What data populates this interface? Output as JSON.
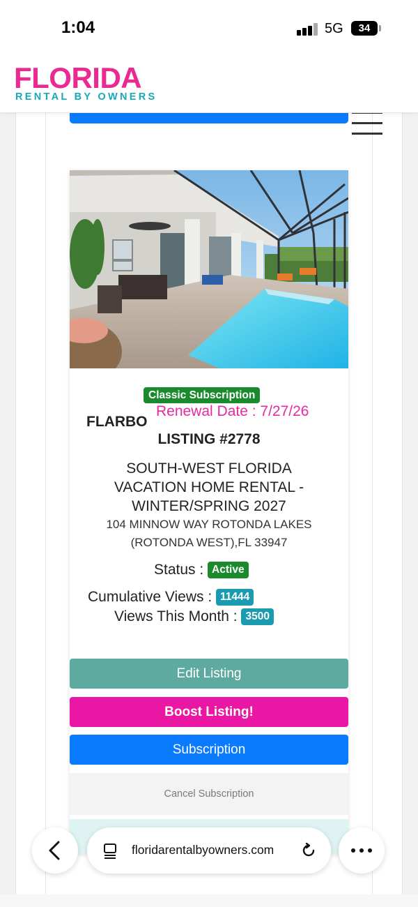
{
  "status_bar": {
    "time": "1:04",
    "network": "5G",
    "battery": "34"
  },
  "header": {
    "logo_main": "FLORIDA",
    "logo_sub": "RENTAL BY OWNERS",
    "logo_main_color": "#ea2a91",
    "logo_sub_color": "#18a9b8"
  },
  "listing": {
    "subscription_badge": "Classic Subscription",
    "owner": "FLARBO",
    "renewal": "Renewal Date : 7/27/26",
    "listing_number": "LISTING #2778",
    "title_lines": [
      "SOUTH-WEST FLORIDA",
      "VACATION HOME RENTAL -",
      "WINTER/SPRING 2027"
    ],
    "address_lines": [
      "104 MINNOW WAY ROTONDA LAKES",
      "(ROTONDA WEST),FL 33947"
    ],
    "status_label": "Status :",
    "status_value": "Active",
    "cumulative_label": "Cumulative Views :",
    "cumulative_value": "11444",
    "month_label": "Views This Month :",
    "month_value": "3500"
  },
  "buttons": {
    "edit": "Edit Listing",
    "boost": "Boost Listing!",
    "subscription": "Subscription",
    "cancel": "Cancel Subscription"
  },
  "browser": {
    "url": "floridarentalbyowners.com"
  },
  "icons": {
    "menu": "hamburger-menu-icon",
    "back": "chevron-left-icon",
    "tabs": "reader-tabs-icon",
    "reload": "reload-icon",
    "more": "more-horizontal-icon"
  }
}
